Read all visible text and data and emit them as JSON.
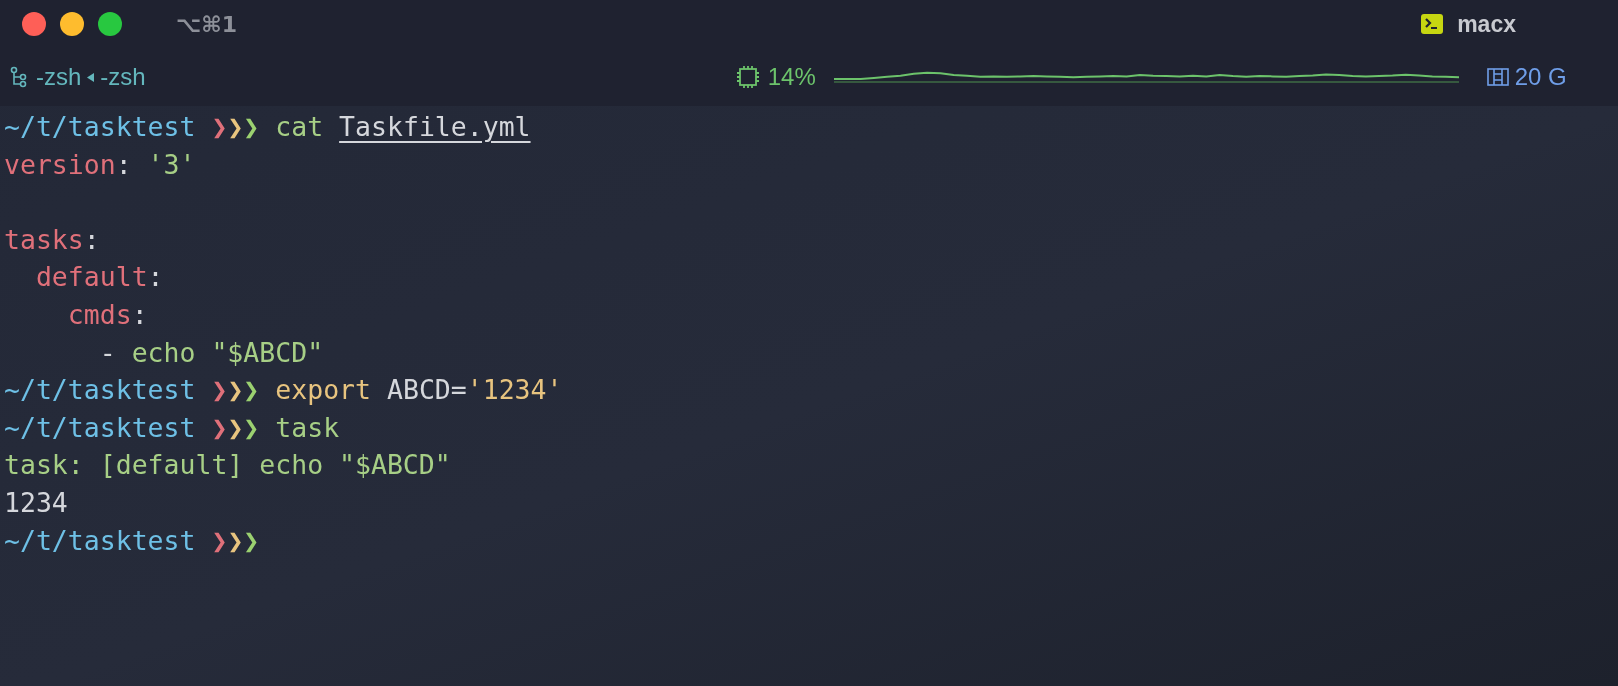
{
  "title_bar": {
    "shortcut": "⌥⌘1",
    "title": "macx"
  },
  "status_bar": {
    "sessions": [
      "-zsh",
      "-zsh"
    ],
    "cpu": "14%",
    "memory": "20 G"
  },
  "terminal": {
    "lines": [
      {
        "kind": "text",
        "segments": [
          {
            "kind": "path",
            "text": "~/t/tasktest "
          },
          {
            "kind": "prompt",
            "text": "❯❯❯"
          },
          {
            "kind": "command",
            "text": " cat "
          },
          {
            "kind": "file",
            "text": "Taskfile.yml"
          }
        ]
      },
      {
        "kind": "text",
        "segments": [
          {
            "kind": "key",
            "text": "version"
          },
          {
            "kind": "plain",
            "text": ": "
          },
          {
            "kind": "string",
            "text": "'3'"
          }
        ]
      },
      {
        "kind": "blank"
      },
      {
        "kind": "text",
        "segments": [
          {
            "kind": "key",
            "text": "tasks"
          },
          {
            "kind": "plain",
            "text": ":"
          }
        ]
      },
      {
        "kind": "text",
        "segments": [
          {
            "kind": "key",
            "text": "  default"
          },
          {
            "kind": "plain",
            "text": ":"
          }
        ]
      },
      {
        "kind": "text",
        "segments": [
          {
            "kind": "key",
            "text": "    cmds"
          },
          {
            "kind": "plain",
            "text": ":"
          }
        ]
      },
      {
        "kind": "text",
        "segments": [
          {
            "kind": "plain",
            "text": "      - "
          },
          {
            "kind": "string",
            "text": "echo \"$ABCD\""
          }
        ]
      },
      {
        "kind": "text",
        "segments": [
          {
            "kind": "path",
            "text": "~/t/tasktest "
          },
          {
            "kind": "prompt",
            "text": "❯❯❯"
          },
          {
            "kind": "keyword",
            "text": " export "
          },
          {
            "kind": "plain",
            "text": "ABCD="
          },
          {
            "kind": "literal",
            "text": "'1234'"
          }
        ]
      },
      {
        "kind": "text",
        "segments": [
          {
            "kind": "path",
            "text": "~/t/tasktest "
          },
          {
            "kind": "prompt",
            "text": "❯❯❯"
          },
          {
            "kind": "command",
            "text": " task"
          }
        ]
      },
      {
        "kind": "text",
        "segments": [
          {
            "kind": "string",
            "text": "task: [default] echo \"$ABCD\""
          }
        ]
      },
      {
        "kind": "text",
        "segments": [
          {
            "kind": "plain",
            "text": "1234"
          }
        ]
      },
      {
        "kind": "text",
        "segments": [
          {
            "kind": "path",
            "text": "~/t/tasktest "
          },
          {
            "kind": "prompt",
            "text": "❯❯❯"
          }
        ]
      }
    ]
  }
}
